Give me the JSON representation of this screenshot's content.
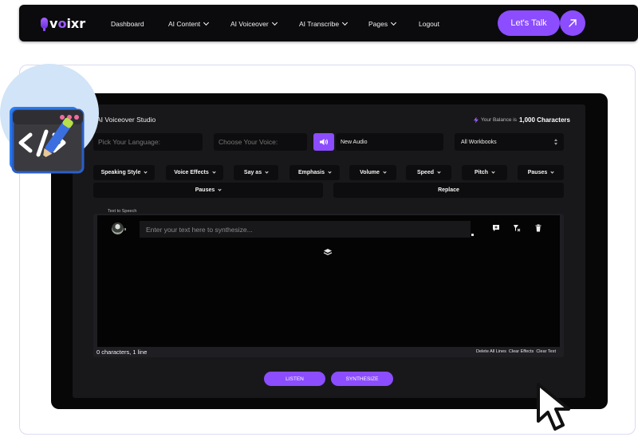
{
  "nav": {
    "logo_text": "v",
    "logo_o": "o",
    "logo_rest": "ixr",
    "links": [
      "Dashboard",
      "AI Content",
      "AI Voiceover",
      "AI Transcribe",
      "Pages",
      "Logout"
    ],
    "cta": "Let's Talk"
  },
  "studio": {
    "title": "AI Voiceover Studio",
    "balance_prefix": "Your Balance is",
    "balance_value": "1,000 Characters",
    "language_placeholder": "Pick Your Language:",
    "voice_placeholder": "Choose Your Voice:",
    "new_audio": "New Audio",
    "workbook": "All Workbooks",
    "options_row1": [
      "Speaking Style",
      "Voice Effects",
      "Say as",
      "Emphasis",
      "Volume",
      "Speed",
      "Pitch",
      "Pauses"
    ],
    "options_row2": [
      "Pauses",
      "Replace"
    ],
    "tts_label": "Text to Speech",
    "text_placeholder": "Enter your text here to synthesize...",
    "counts": "0 characters, 1 line",
    "footer_links": [
      "Delete All Lines",
      "Clear Effects",
      "Clear Text"
    ],
    "listen": "LISTEN",
    "synthesize": "SYNTHESIZE"
  },
  "colors": {
    "accent": "#8b4dff",
    "nav_bg": "#0b0b0e",
    "panel_bg": "#18181b"
  }
}
